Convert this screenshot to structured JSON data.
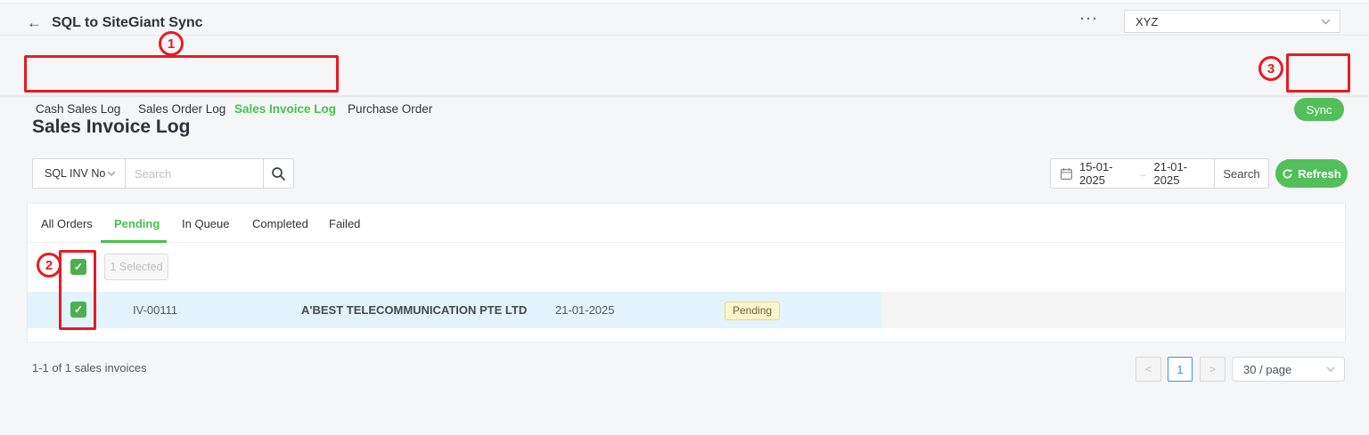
{
  "colors": {
    "accent_green": "#47c14e",
    "button_green": "#53bf5b",
    "annotation_red": "#e51c23",
    "selected_row_blue": "#e3f3fc",
    "badge_bg": "#fdf5c8",
    "pagination_active_blue": "#3d96d2",
    "checkbox_green": "#4caf50"
  },
  "header": {
    "title": "SQL to SiteGiant Sync",
    "back_label": "←",
    "more_label": "···",
    "account_select": {
      "value": "XYZ"
    }
  },
  "nav_tabs": {
    "items": [
      {
        "label": "Cash Sales Log",
        "active": false
      },
      {
        "label": "Sales Order Log",
        "active": false
      },
      {
        "label": "Sales Invoice Log",
        "active": true
      },
      {
        "label": "Purchase Order",
        "active": false
      }
    ],
    "sync_button": "Sync"
  },
  "page": {
    "heading": "Sales Invoice Log"
  },
  "filters": {
    "field_select": "SQL INV No",
    "search_placeholder": "Search",
    "date_from": "15-01-2025",
    "date_to": "21-01-2025",
    "range_arrow": "→",
    "search_button": "Search",
    "refresh_button": "Refresh"
  },
  "status_tabs": {
    "items": [
      {
        "label": "All Orders",
        "active": false
      },
      {
        "label": "Pending",
        "active": true
      },
      {
        "label": "In Queue",
        "active": false
      },
      {
        "label": "Completed",
        "active": false
      },
      {
        "label": "Failed",
        "active": false
      }
    ]
  },
  "selection": {
    "selected_button": "1 Selected",
    "check_glyph": "✓"
  },
  "table": {
    "rows": [
      {
        "invoice_no": "IV-00111",
        "customer": "A'BEST TELECOMMUNICATION PTE LTD",
        "date": "21-01-2025",
        "status": "Pending",
        "selected": true
      }
    ]
  },
  "footer": {
    "total_text": "1-1 of 1 sales invoices",
    "pagination": {
      "prev": "<",
      "current_page": "1",
      "next": ">",
      "page_size": "30 / page"
    }
  },
  "annotations": {
    "labels": [
      "1",
      "2",
      "3"
    ]
  }
}
